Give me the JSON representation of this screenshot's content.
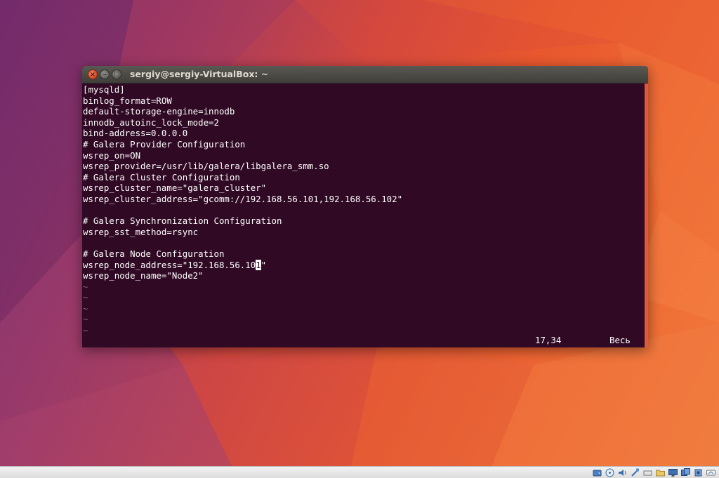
{
  "window": {
    "title": "sergiy@sergiy-VirtualBox: ~",
    "buttons": {
      "close": "×",
      "minimize": "–",
      "maximize": "□"
    }
  },
  "editor": {
    "lines": [
      "[mysqld]",
      "binlog_format=ROW",
      "default-storage-engine=innodb",
      "innodb_autoinc_lock_mode=2",
      "bind-address=0.0.0.0",
      "# Galera Provider Configuration",
      "wsrep_on=ON",
      "wsrep_provider=/usr/lib/galera/libgalera_smm.so",
      "# Galera Cluster Configuration",
      "wsrep_cluster_name=\"galera_cluster\"",
      "wsrep_cluster_address=\"gcomm://192.168.56.101,192.168.56.102\"",
      "",
      "# Galera Synchronization Configuration",
      "wsrep_sst_method=rsync",
      "",
      "# Galera Node Configuration",
      "wsrep_node_address=\"192.168.56.10",
      "wsrep_node_name=\"Node2\""
    ],
    "cursor_line": {
      "before": "wsrep_node_address=\"192.168.56.10",
      "cursor_char": "1",
      "after": "\""
    },
    "tilde_lines": [
      "~",
      "~",
      "~",
      "~",
      "~"
    ],
    "status": {
      "position": "17,34",
      "range": "Весь"
    }
  },
  "colors": {
    "terminal_bg": "#300a24",
    "terminal_fg": "#ffffff",
    "titlebar": "#4a4945",
    "close_button": "#e0502b",
    "wallpaper_accent": "#e8572e"
  },
  "statusbar_icons": [
    "hard-disk-icon",
    "optical-drive-icon",
    "audio-icon",
    "network-icon",
    "usb-icon",
    "shared-folders-icon",
    "display-icon",
    "video-capture-icon",
    "cpu-icon",
    "host-key-icon"
  ]
}
